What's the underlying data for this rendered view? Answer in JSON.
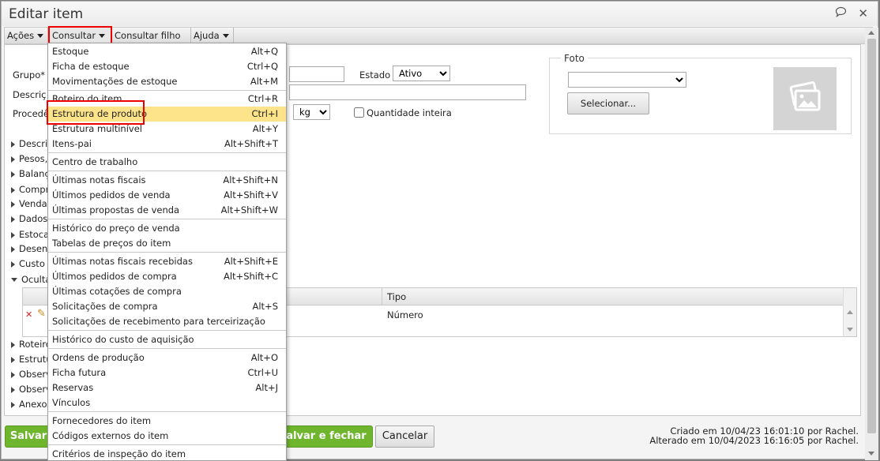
{
  "window": {
    "title": "Editar item"
  },
  "menubar": {
    "items": [
      {
        "label": "Ações"
      },
      {
        "label": "Consultar"
      },
      {
        "label": "Consultar filho"
      },
      {
        "label": "Ajuda"
      }
    ]
  },
  "form": {
    "grupo_label": "Grupo*",
    "descricao_label": "Descriç",
    "procedencia_label": "Procedê",
    "estado_label": "Estado",
    "estado_value": "Ativo",
    "unit_value": "kg",
    "qtd_inteira_label": "Quantidade inteira",
    "foto_legend": "Foto",
    "selecionar_label": "Selecionar..."
  },
  "sections": [
    "Descri",
    "Pesos,",
    "Balanç",
    "Compr",
    "Venda",
    "Dados",
    "Estoca",
    "Desenl",
    "Custo",
    "Ocultar",
    "Roteiro",
    "Estrutu",
    "Observ",
    "Observ",
    "Anexos"
  ],
  "grid": {
    "col_tipo": "Tipo",
    "row_tipo": "Número"
  },
  "dropdown": {
    "items": [
      {
        "label": "Estoque",
        "shortcut": "Alt+Q"
      },
      {
        "label": "Ficha de estoque",
        "shortcut": "Ctrl+Q"
      },
      {
        "label": "Movimentações de estoque",
        "shortcut": "Alt+M"
      },
      {
        "label": "Roteiro do item",
        "shortcut": "Ctrl+R"
      },
      {
        "label": "Estrutura de produto",
        "shortcut": "Ctrl+I"
      },
      {
        "label": "Estrutura multinível",
        "shortcut": "Alt+Y"
      },
      {
        "label": "Itens-pai",
        "shortcut": "Alt+Shift+T"
      },
      {
        "label": "Centro de trabalho",
        "shortcut": ""
      },
      {
        "label": "Últimas notas fiscais",
        "shortcut": "Alt+Shift+N"
      },
      {
        "label": "Últimos pedidos de venda",
        "shortcut": "Alt+Shift+V"
      },
      {
        "label": "Últimas propostas de venda",
        "shortcut": "Alt+Shift+W"
      },
      {
        "label": "Histórico do preço de venda",
        "shortcut": ""
      },
      {
        "label": "Tabelas de preços do item",
        "shortcut": ""
      },
      {
        "label": "Últimas notas fiscais recebidas",
        "shortcut": "Alt+Shift+E"
      },
      {
        "label": "Últimos pedidos de compra",
        "shortcut": "Alt+Shift+C"
      },
      {
        "label": "Últimas cotações de compra",
        "shortcut": ""
      },
      {
        "label": "Solicitações de compra",
        "shortcut": "Alt+S"
      },
      {
        "label": "Solicitações de recebimento para terceirização",
        "shortcut": ""
      },
      {
        "label": "Histórico do custo de aquisição",
        "shortcut": ""
      },
      {
        "label": "Ordens de produção",
        "shortcut": "Alt+O"
      },
      {
        "label": "Ficha futura",
        "shortcut": "Ctrl+U"
      },
      {
        "label": "Reservas",
        "shortcut": "Alt+J"
      },
      {
        "label": "Vínculos",
        "shortcut": ""
      },
      {
        "label": "Fornecedores do item",
        "shortcut": ""
      },
      {
        "label": "Códigos externos do item",
        "shortcut": ""
      },
      {
        "label": "Critérios de inspeção do item",
        "shortcut": ""
      }
    ]
  },
  "footer": {
    "salvar_label": "Salvar",
    "salvar_fechar_label": "alvar e fechar",
    "cancelar_label": "Cancelar",
    "criado": "Criado em 10/04/23 16:01:10 por Rachel.",
    "alterado": "Alterado em 10/04/2023 16:16:05 por Rachel."
  },
  "colors": {
    "accent_green": "#6fb52e",
    "highlight": "#fde38a",
    "annotation_red": "#e00000"
  },
  "icons": [
    "speech-bubble-icon",
    "close-icon",
    "image-placeholder-icon",
    "delete-icon",
    "edit-pencil-icon",
    "chevron-down-icon"
  ]
}
